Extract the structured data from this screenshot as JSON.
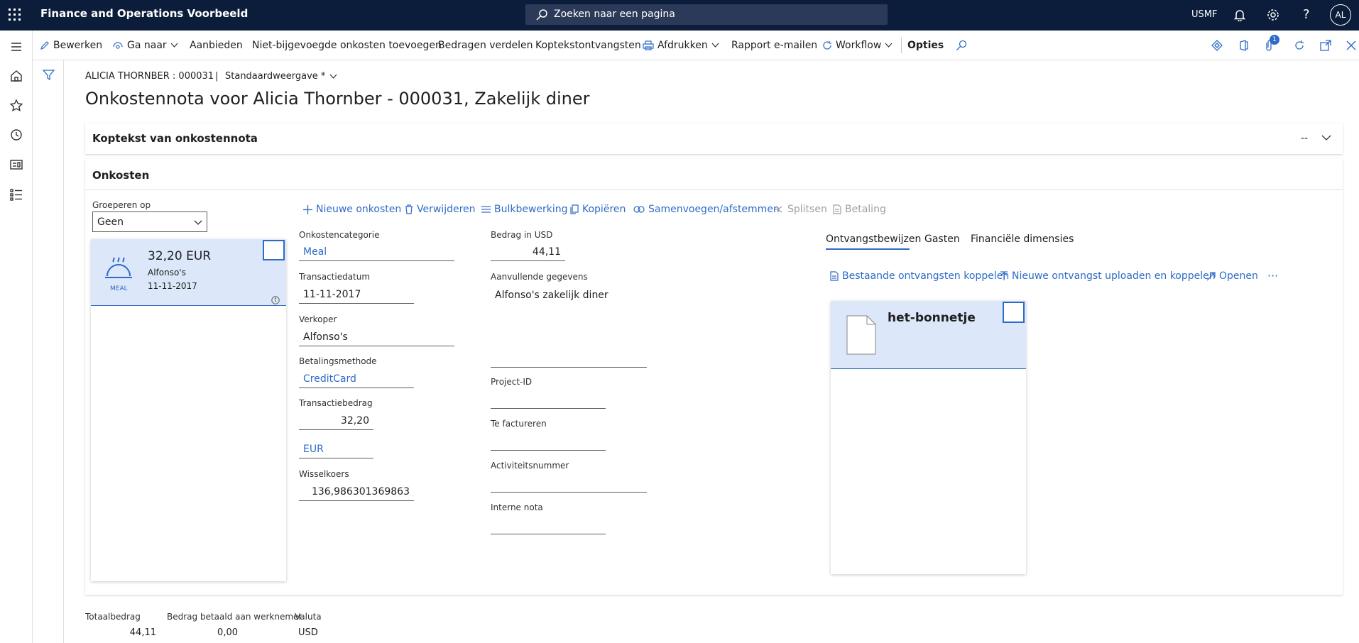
{
  "topbar": {
    "app_title": "Finance and Operations Voorbeeld",
    "search_placeholder": "Zoeken naar een pagina",
    "company": "USMF",
    "user_initials": "AL"
  },
  "actionbar": {
    "edit": "Bewerken",
    "goto": "Ga naar",
    "submit": "Aanbieden",
    "add_unattached": "Niet-bijgevoegde onkosten toevoegen",
    "distribute": "Bedragen verdelen",
    "header_receipts": "Koptekstontvangsten",
    "print": "Afdrukken",
    "email_report": "Rapport e-mailen",
    "workflow": "Workflow",
    "options": "Opties",
    "notification_count": "1"
  },
  "page": {
    "breadcrumb_record": "ALICIA THORNBER : 000031",
    "separator": "|",
    "view_name": "Standaardweergave *",
    "title": "Onkostennota voor Alicia Thornber - 000031, Zakelijk diner"
  },
  "header_section": {
    "title": "Koptekst van onkostennota",
    "summary": "--"
  },
  "expenses_section": {
    "title": "Onkosten",
    "group_by_label": "Groeperen op",
    "group_by_value": "Geen",
    "toolbar": {
      "new": "Nieuwe onkosten",
      "delete": "Verwijderen",
      "bulk_edit": "Bulkbewerking",
      "copy": "Kopiëren",
      "merge": "Samenvoegen/afstemmen",
      "split": "Splitsen",
      "payment": "Betaling"
    },
    "card": {
      "amount": "32,20 EUR",
      "merchant": "Alfonso's",
      "date": "11-11-2017",
      "category_caption": "MEAL"
    },
    "fields": {
      "category_label": "Onkostencategorie",
      "category_value": "Meal",
      "date_label": "Transactiedatum",
      "date_value": "11-11-2017",
      "merchant_label": "Verkoper",
      "merchant_value": "Alfonso's",
      "payment_label": "Betalingsmethode",
      "payment_value": "CreditCard",
      "amount_label": "Transactiebedrag",
      "amount_value": "32,20",
      "currency_value": "EUR",
      "rate_label": "Wisselkoers",
      "rate_value": "136,986301369863",
      "usd_label": "Bedrag in USD",
      "usd_value": "44,11",
      "extra_label": "Aanvullende gegevens",
      "extra_value": "Alfonso's zakelijk diner",
      "project_label": "Project-ID",
      "bill_label": "Te factureren",
      "activity_label": "Activiteitsnummer",
      "note_label": "Interne nota"
    },
    "tabs": {
      "receipts": "Ontvangstbewijzen",
      "guests": "Gasten",
      "dimensions": "Financiële dimensies"
    },
    "receipt_actions": {
      "attach_existing": "Bestaande ontvangsten koppelen",
      "upload_new": "Nieuwe ontvangst uploaden en koppelen",
      "open": "Openen",
      "more": "···"
    },
    "receipt_name": "het-bonnetje"
  },
  "totals": {
    "total_label": "Totaalbedrag",
    "total_value": "44,11",
    "paid_label": "Bedrag betaald aan werknemer",
    "paid_value": "0,00",
    "currency_label": "Valuta",
    "currency_value": "USD"
  },
  "colors": {
    "topbar": "#0b1d3a",
    "accent": "#2e6bc7",
    "card_selected": "#dce8f9"
  }
}
